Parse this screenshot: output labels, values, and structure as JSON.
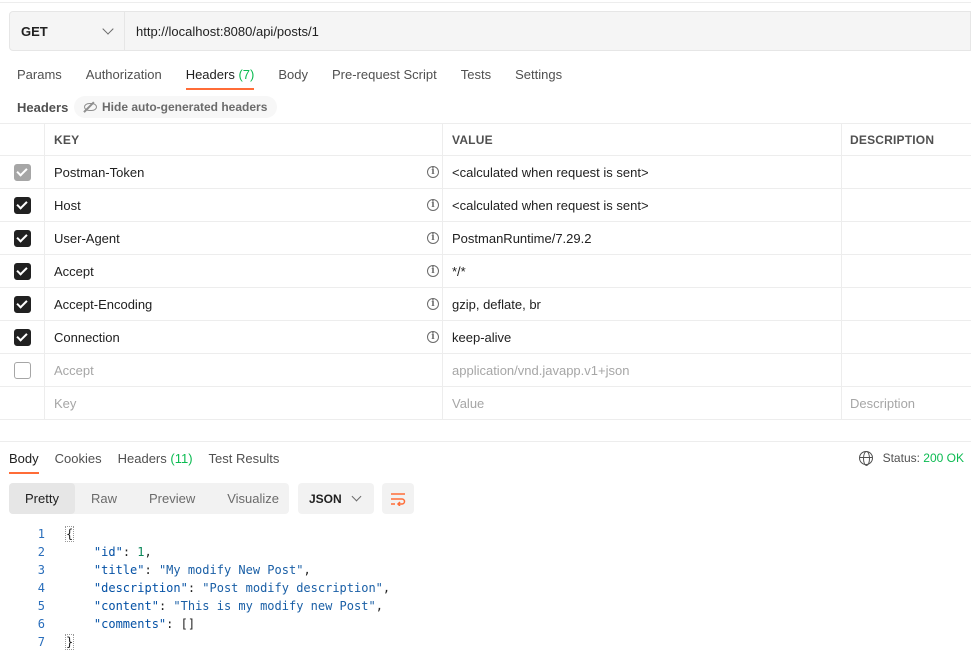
{
  "request": {
    "method": "GET",
    "url": "http://localhost:8080/api/posts/1"
  },
  "request_tabs": [
    {
      "label": "Params"
    },
    {
      "label": "Authorization"
    },
    {
      "label": "Headers",
      "count": "(7)"
    },
    {
      "label": "Body"
    },
    {
      "label": "Pre-request Script"
    },
    {
      "label": "Tests"
    },
    {
      "label": "Settings"
    }
  ],
  "headers_section": {
    "title": "Headers",
    "hide_button": "Hide auto-generated headers"
  },
  "table": {
    "columns": {
      "key": "KEY",
      "value": "VALUE",
      "description": "DESCRIPTION"
    },
    "rows": [
      {
        "key": "Postman-Token",
        "value": "<calculated when request is sent>",
        "checked": "disabled"
      },
      {
        "key": "Host",
        "value": "<calculated when request is sent>",
        "checked": "on"
      },
      {
        "key": "User-Agent",
        "value": "PostmanRuntime/7.29.2",
        "checked": "on"
      },
      {
        "key": "Accept",
        "value": "*/*",
        "checked": "on"
      },
      {
        "key": "Accept-Encoding",
        "value": "gzip, deflate, br",
        "checked": "on"
      },
      {
        "key": "Connection",
        "value": "keep-alive",
        "checked": "on"
      },
      {
        "key": "Accept",
        "value": "application/vnd.javapp.v1+json",
        "checked": "off"
      }
    ],
    "placeholders": {
      "key": "Key",
      "value": "Value",
      "description": "Description"
    }
  },
  "response_tabs": [
    {
      "label": "Body"
    },
    {
      "label": "Cookies"
    },
    {
      "label": "Headers",
      "count": "(11)"
    },
    {
      "label": "Test Results"
    }
  ],
  "status": {
    "label": "Status:",
    "value": "200 OK"
  },
  "view_modes": [
    "Pretty",
    "Raw",
    "Preview",
    "Visualize"
  ],
  "format": "JSON",
  "code": {
    "line_numbers": [
      "1",
      "2",
      "3",
      "4",
      "5",
      "6",
      "7"
    ],
    "open": "{",
    "close": "}",
    "fields": [
      {
        "key": "\"id\"",
        "value": "1",
        "type": "n",
        "comma": ","
      },
      {
        "key": "\"title\"",
        "value": "\"My modify New Post\"",
        "type": "s",
        "comma": ","
      },
      {
        "key": "\"description\"",
        "value": "\"Post modify description\"",
        "type": "s",
        "comma": ","
      },
      {
        "key": "\"content\"",
        "value": "\"This is my modify new Post\"",
        "type": "s",
        "comma": ","
      },
      {
        "key": "\"comments\"",
        "value": "[]",
        "type": "p",
        "comma": ""
      }
    ]
  },
  "colors": {
    "accent": "#ff6c37",
    "success": "#0cbb52"
  }
}
